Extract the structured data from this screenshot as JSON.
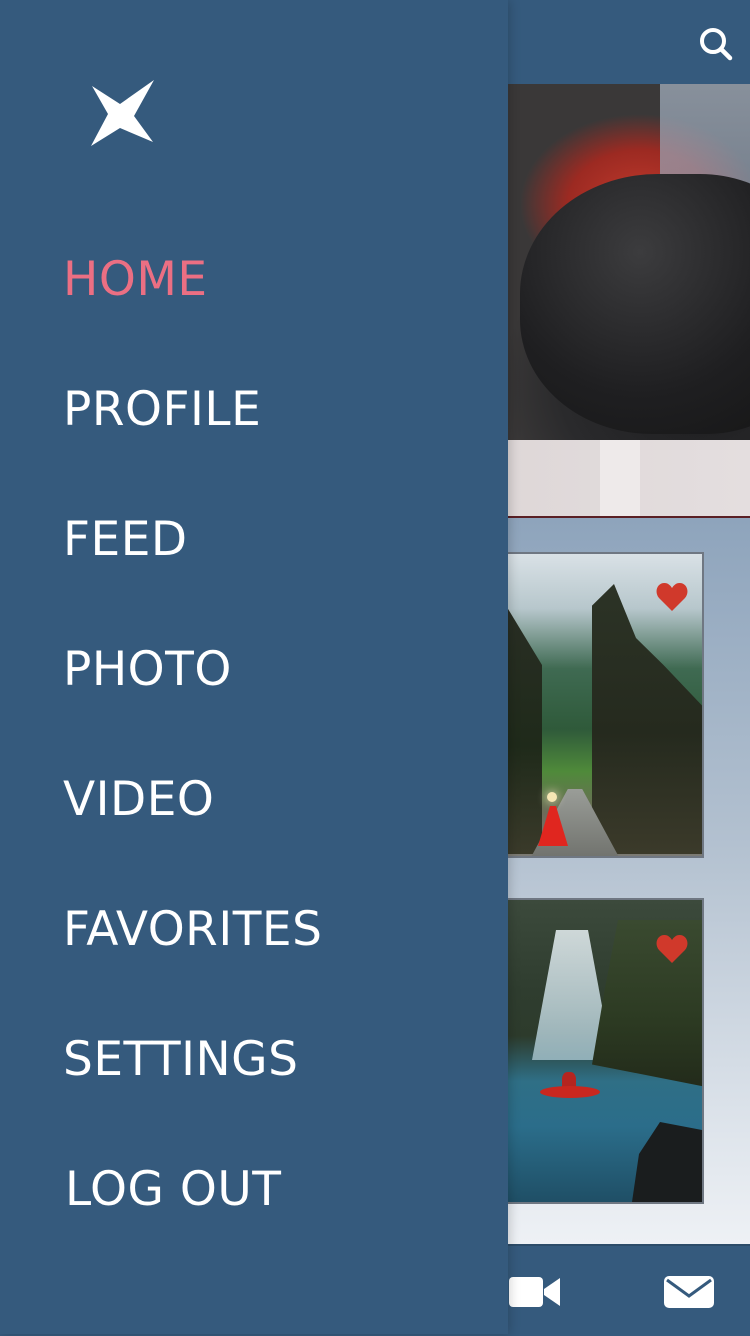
{
  "menu": {
    "items": [
      {
        "label": "HOME",
        "active": true
      },
      {
        "label": "PROFILE",
        "active": false
      },
      {
        "label": "FEED",
        "active": false
      },
      {
        "label": "PHOTO",
        "active": false
      },
      {
        "label": "VIDEO",
        "active": false
      },
      {
        "label": "FAVORITES",
        "active": false
      },
      {
        "label": "SETTINGS",
        "active": false
      },
      {
        "label": "LOG OUT",
        "active": false
      }
    ]
  },
  "icons": {
    "logo": "star-logo-icon",
    "search": "search-icon",
    "heart": "heart-icon",
    "video": "video-camera-icon",
    "mail": "mail-icon"
  },
  "colors": {
    "primary": "#355a7d",
    "active_menu": "#eb6f83",
    "menu_text": "#ffffff",
    "heart": "#d0392b"
  }
}
